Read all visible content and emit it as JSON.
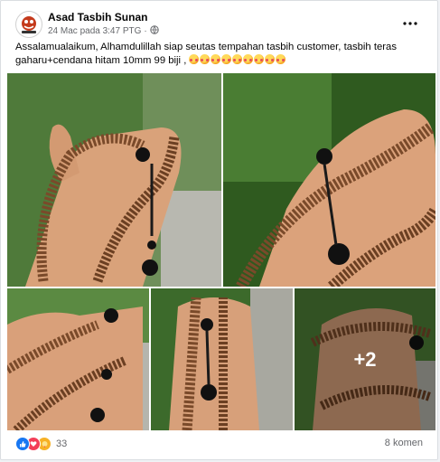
{
  "post": {
    "page_name": "Asad Tasbih Sunan",
    "time": "24 Mac pada 3:47 PTG",
    "separator": "·",
    "text_line1": "Assalamualaikum, Alhamdulillah siap seutas tempahan tasbih customer, tasbih teras",
    "text_line2": "gaharu+cendana hitam 10mm 99 biji ,",
    "emoji_count": 9
  },
  "photos": {
    "more_overlay": "+2"
  },
  "footer": {
    "reaction_count": "33",
    "comments": "8 komen"
  },
  "icons": {
    "avatar": "avatar-logo",
    "privacy": "globe-icon",
    "more": "more-options-icon",
    "reactions": [
      "like-reaction-icon",
      "love-reaction-icon",
      "care-reaction-icon"
    ]
  },
  "colors": {
    "like": "#1877f2",
    "love": "#f33e58",
    "care": "#f7b125",
    "meta_text": "#65676b"
  }
}
